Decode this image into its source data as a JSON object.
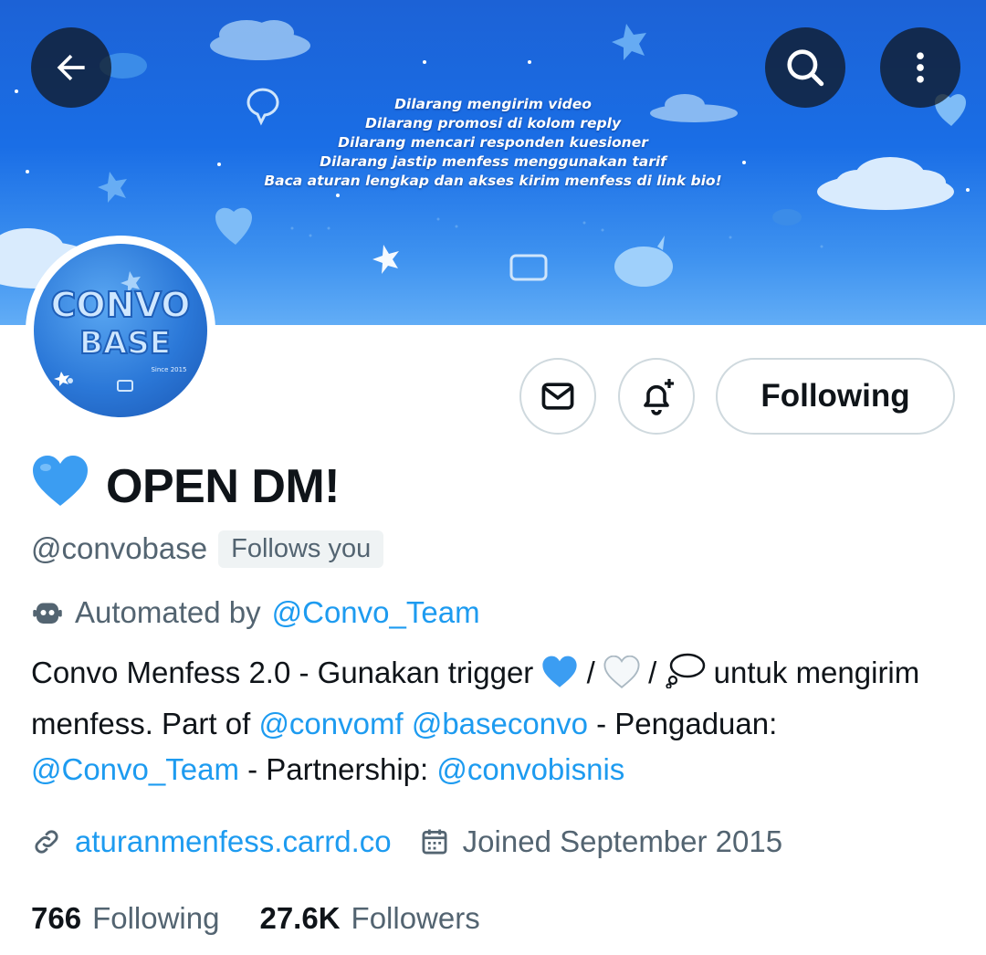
{
  "header": {
    "banner_rules": [
      "Dilarang mengirim video",
      "Dilarang promosi di kolom reply",
      "Dilarang mencari responden kuesioner",
      "Dilarang jastip menfess menggunakan tarif",
      "Baca aturan lengkap dan akses kirim menfess di link bio!"
    ],
    "back_icon": "arrow-left-icon",
    "search_icon": "search-icon",
    "more_icon": "more-vertical-icon"
  },
  "avatar": {
    "logo_text_1": "CONVO",
    "logo_text_2": "BASE",
    "logo_tagline": "Since 2015"
  },
  "actions": {
    "message_icon": "mail-icon",
    "notify_icon": "bell-plus-icon",
    "following_label": "Following"
  },
  "profile": {
    "display_emoji": "💙",
    "display_name": "OPEN DM!",
    "handle": "@convobase",
    "follows_you": "Follows you",
    "automated_prefix": "Automated by",
    "automated_by": "@Convo_Team",
    "bio": {
      "part1": "Convo Menfess 2.0 - Gunakan trigger",
      "emoji1": "💙",
      "sep1": " / ",
      "emoji2": "🤍",
      "sep2": " / ",
      "emoji3": "💭",
      "part2": " untuk mengirim menfess. Part of ",
      "mention1": "@convomf",
      "space": " ",
      "mention2": "@baseconvo",
      "part3": " - Pengaduan: ",
      "mention3": "@Convo_Team",
      "part4": " - Partnership: ",
      "mention4": "@convobisnis"
    },
    "website": "aturanmenfess.carrd.co",
    "joined": "Joined September 2015",
    "following_count": "766",
    "following_label": "Following",
    "followers_count": "27.6K",
    "followers_label": "Followers"
  },
  "colors": {
    "accent": "#1d9bf0",
    "secondary_text": "#536471",
    "primary_text": "#0f1419",
    "banner_blue": "#1a6ee6"
  }
}
